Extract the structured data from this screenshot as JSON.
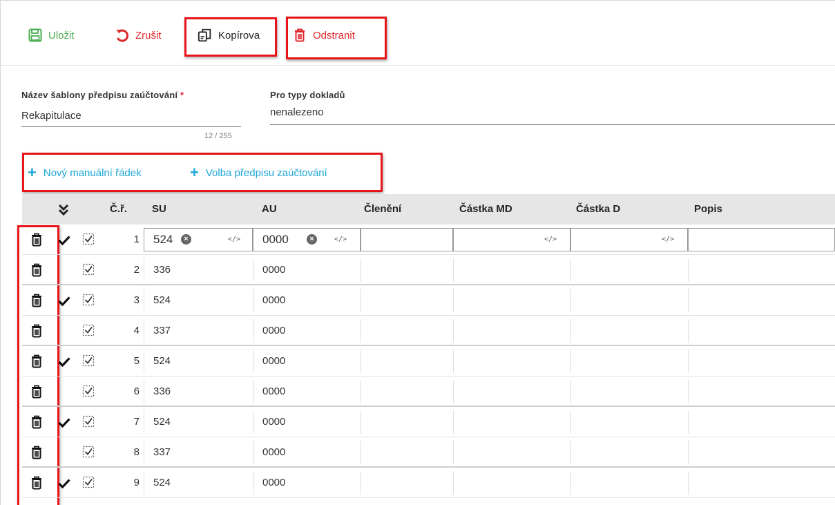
{
  "toolbar": {
    "save_label": "Uložit",
    "cancel_label": "Zrušit",
    "copy_label": "Kopírova",
    "delete_label": "Odstranit"
  },
  "form": {
    "name_label": "Název šablony předpisu zaúčtování",
    "required_mark": "*",
    "name_value": "Rekapitulace",
    "name_counter": "12 / 255",
    "doc_types_label": "Pro typy dokladů",
    "doc_types_value": "nenalezeno"
  },
  "actions": {
    "new_manual_row": "Nový manuální řádek",
    "choose_template": "Volba předpisu zaúčtování"
  },
  "grid": {
    "headers": {
      "expand": "»",
      "row_no": "Č.ř.",
      "su": "SU",
      "au": "AU",
      "cleneni": "Členění",
      "castka_md": "Částka MD",
      "castka_d": "Částka D",
      "popis": "Popis"
    },
    "rows": [
      {
        "no": "1",
        "su": "524",
        "au": "0000",
        "checked": true
      },
      {
        "no": "2",
        "su": "336",
        "au": "0000",
        "checked": false
      },
      {
        "no": "3",
        "su": "524",
        "au": "0000",
        "checked": true
      },
      {
        "no": "4",
        "su": "337",
        "au": "0000",
        "checked": false
      },
      {
        "no": "5",
        "su": "524",
        "au": "0000",
        "checked": true
      },
      {
        "no": "6",
        "su": "336",
        "au": "0000",
        "checked": false
      },
      {
        "no": "7",
        "su": "524",
        "au": "0000",
        "checked": true
      },
      {
        "no": "8",
        "su": "337",
        "au": "0000",
        "checked": false
      },
      {
        "no": "9",
        "su": "524",
        "au": "0000",
        "checked": true
      }
    ]
  },
  "colors": {
    "save": "#4caf50",
    "danger": "#e0262a",
    "accent": "#1ba6d6",
    "highlight": "#e8141a"
  }
}
